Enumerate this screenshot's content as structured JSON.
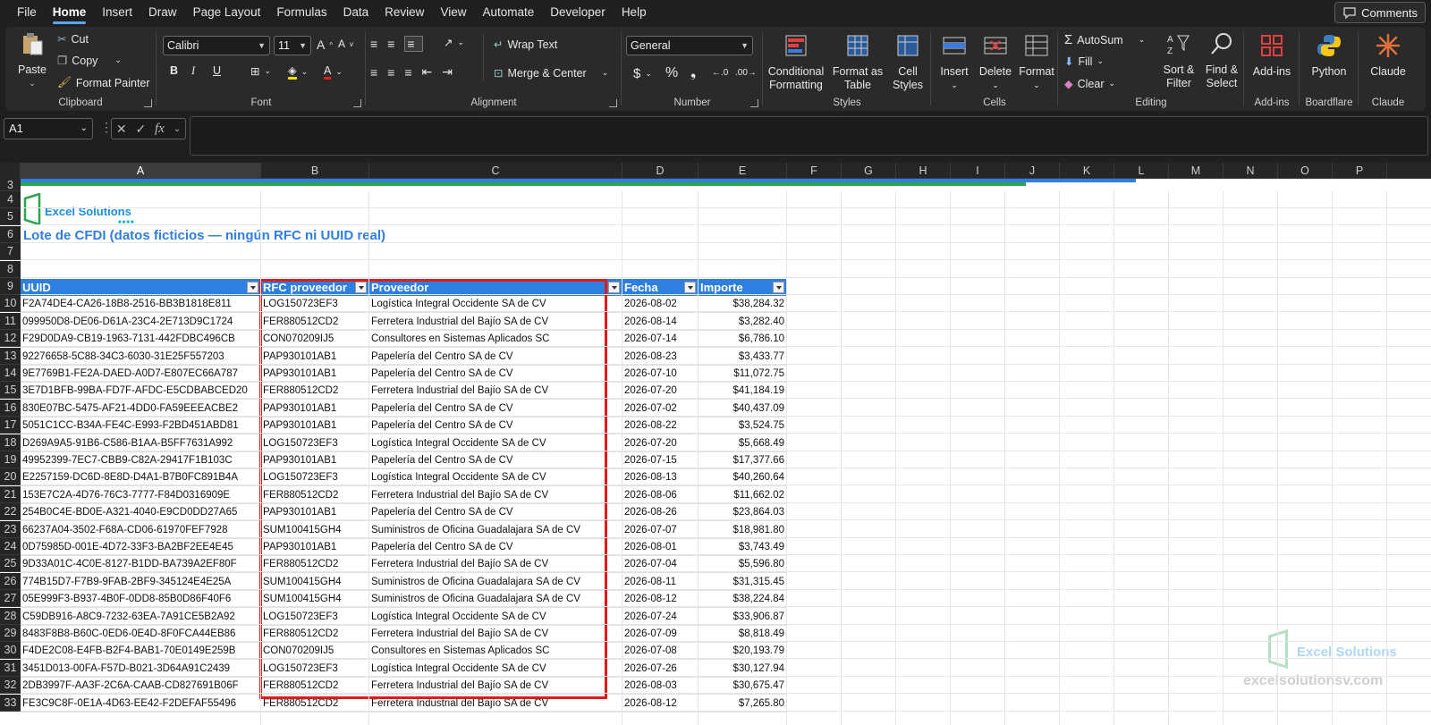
{
  "menu": {
    "tabs": [
      "File",
      "Home",
      "Insert",
      "Draw",
      "Page Layout",
      "Formulas",
      "Data",
      "Review",
      "View",
      "Automate",
      "Developer",
      "Help"
    ],
    "active": "Home",
    "comments_label": "Comments"
  },
  "ribbon": {
    "clipboard": {
      "paste": "Paste",
      "cut": "Cut",
      "copy": "Copy",
      "format_painter": "Format Painter",
      "label": "Clipboard"
    },
    "font": {
      "name": "Calibri",
      "size": "11",
      "label": "Font",
      "bold": "B",
      "italic": "I",
      "underline": "U"
    },
    "alignment": {
      "wrap": "Wrap Text",
      "merge": "Merge & Center",
      "label": "Alignment"
    },
    "number": {
      "format": "General",
      "label": "Number",
      "currency": "$",
      "percent": "%"
    },
    "styles": {
      "conditional": "Conditional Formatting",
      "format_table": "Format as Table",
      "cell_styles": "Cell Styles",
      "label": "Styles"
    },
    "cells": {
      "insert": "Insert",
      "delete": "Delete",
      "format": "Format",
      "label": "Cells"
    },
    "editing": {
      "autosum": "AutoSum",
      "fill": "Fill",
      "clear": "Clear",
      "sort": "Sort & Filter",
      "find": "Find & Select",
      "label": "Editing"
    },
    "addins": {
      "addins": "Add-ins",
      "label": "Add-ins"
    },
    "python": {
      "python": "Python",
      "label": "Boardflare"
    },
    "claude": {
      "claude": "Claude",
      "label": "Claude"
    }
  },
  "formula_bar": {
    "name_box": "A1",
    "fx": "fx",
    "value": ""
  },
  "columns": [
    "A",
    "B",
    "C",
    "D",
    "E",
    "F",
    "G",
    "H",
    "I",
    "J",
    "K",
    "L",
    "M",
    "N",
    "O",
    "P"
  ],
  "sheet": {
    "logo_text": "Excel Solutions",
    "title": "Lote de CFDI (datos ficticios — ningún RFC ni UUID real)",
    "headers": [
      "UUID",
      "RFC proveedor",
      "Proveedor",
      "Fecha",
      "Importe"
    ],
    "rows": [
      [
        "F2A74DE4-CA26-18B8-2516-BB3B1818E811",
        "LOG150723EF3",
        "Logística Integral Occidente SA de CV",
        "2026-08-02",
        "$38,284.32"
      ],
      [
        "099950D8-DE06-D61A-23C4-2E713D9C1724",
        "FER880512CD2",
        "Ferretera Industrial del Bajío SA de CV",
        "2026-08-14",
        "$3,282.40"
      ],
      [
        "F29D0DA9-CB19-1963-7131-442FDBC496CB",
        "CON070209IJ5",
        "Consultores en Sistemas Aplicados SC",
        "2026-07-14",
        "$6,786.10"
      ],
      [
        "92276658-5C88-34C3-6030-31E25F557203",
        "PAP930101AB1",
        "Papelería del Centro SA de CV",
        "2026-08-23",
        "$3,433.77"
      ],
      [
        "9E7769B1-FE2A-DAED-A0D7-E807EC66A787",
        "PAP930101AB1",
        "Papelería del Centro SA de CV",
        "2026-07-10",
        "$11,072.75"
      ],
      [
        "3E7D1BFB-99BA-FD7F-AFDC-E5CDBABCED20",
        "FER880512CD2",
        "Ferretera Industrial del Bajío SA de CV",
        "2026-07-20",
        "$41,184.19"
      ],
      [
        "830E07BC-5475-AF21-4DD0-FA59EEEACBE2",
        "PAP930101AB1",
        "Papelería del Centro SA de CV",
        "2026-07-02",
        "$40,437.09"
      ],
      [
        "5051C1CC-B34A-FE4C-E993-F2BD451ABD81",
        "PAP930101AB1",
        "Papelería del Centro SA de CV",
        "2026-08-22",
        "$3,524.75"
      ],
      [
        "D269A9A5-91B6-C586-B1AA-B5FF7631A992",
        "LOG150723EF3",
        "Logística Integral Occidente SA de CV",
        "2026-07-20",
        "$5,668.49"
      ],
      [
        "49952399-7EC7-CBB9-C82A-29417F1B103C",
        "PAP930101AB1",
        "Papelería del Centro SA de CV",
        "2026-07-15",
        "$17,377.66"
      ],
      [
        "E2257159-DC6D-8E8D-D4A1-B7B0FC891B4A",
        "LOG150723EF3",
        "Logística Integral Occidente SA de CV",
        "2026-08-13",
        "$40,260.64"
      ],
      [
        "153E7C2A-4D76-76C3-7777-F84D0316909E",
        "FER880512CD2",
        "Ferretera Industrial del Bajío SA de CV",
        "2026-08-06",
        "$11,662.02"
      ],
      [
        "254B0C4E-BD0E-A321-4040-E9CD0DD27A65",
        "PAP930101AB1",
        "Papelería del Centro SA de CV",
        "2026-08-26",
        "$23,864.03"
      ],
      [
        "66237A04-3502-F68A-CD06-61970FEF7928",
        "SUM100415GH4",
        "Suministros de Oficina Guadalajara SA de CV",
        "2026-07-07",
        "$18,981.80"
      ],
      [
        "0D75985D-001E-4D72-33F3-BA2BF2EE4E45",
        "PAP930101AB1",
        "Papelería del Centro SA de CV",
        "2026-08-01",
        "$3,743.49"
      ],
      [
        "9D33A01C-4C0E-8127-B1DD-BA739A2EF80F",
        "FER880512CD2",
        "Ferretera Industrial del Bajío SA de CV",
        "2026-07-04",
        "$5,596.80"
      ],
      [
        "774B15D7-F7B9-9FAB-2BF9-345124E4E25A",
        "SUM100415GH4",
        "Suministros de Oficina Guadalajara SA de CV",
        "2026-08-11",
        "$31,315.45"
      ],
      [
        "05E999F3-B937-4B0F-0DD8-85B0D86F40F6",
        "SUM100415GH4",
        "Suministros de Oficina Guadalajara SA de CV",
        "2026-08-12",
        "$38,224.84"
      ],
      [
        "C59DB916-A8C9-7232-63EA-7A91CE5B2A92",
        "LOG150723EF3",
        "Logística Integral Occidente SA de CV",
        "2026-07-24",
        "$33,906.87"
      ],
      [
        "8483F8B8-B60C-0ED6-0E4D-8F0FCA44EB86",
        "FER880512CD2",
        "Ferretera Industrial del Bajío SA de CV",
        "2026-07-09",
        "$8,818.49"
      ],
      [
        "F4DE2C08-E4FB-B2F4-BAB1-70E0149E259B",
        "CON070209IJ5",
        "Consultores en Sistemas Aplicados SC",
        "2026-07-08",
        "$20,193.79"
      ],
      [
        "3451D013-00FA-F57D-B021-3D64A91C2439",
        "LOG150723EF3",
        "Logística Integral Occidente SA de CV",
        "2026-07-26",
        "$30,127.94"
      ],
      [
        "2DB3997F-AA3F-2C6A-CAAB-CD827691B06F",
        "FER880512CD2",
        "Ferretera Industrial del Bajío SA de CV",
        "2026-08-03",
        "$30,675.47"
      ],
      [
        "FE3C9C8F-0E1A-4D63-EE42-F2DEFAF55496",
        "FER880512CD2",
        "Ferretera Industrial del Bajío SA de CV",
        "2026-08-12",
        "$7,265.80"
      ]
    ],
    "row_numbers": [
      "3",
      "4",
      "5",
      "6",
      "7",
      "8",
      "9",
      "10",
      "11",
      "12",
      "13",
      "14",
      "15",
      "16",
      "17",
      "18",
      "19",
      "20",
      "21",
      "22",
      "23",
      "24",
      "25",
      "26",
      "27",
      "28",
      "29",
      "30",
      "31",
      "32",
      "33"
    ],
    "watermark_text": "Excel Solutions",
    "watermark_url": "excelsolutionsv.com"
  },
  "colors": {
    "header_blue": "#2f7fe0",
    "highlight_red": "#e01b1b",
    "accent_green": "#2ea44f"
  }
}
